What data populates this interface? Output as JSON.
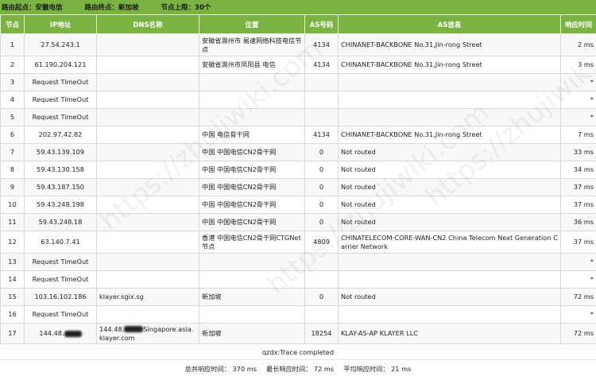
{
  "header": {
    "origin": "路由起点：安徽电信",
    "destination": "路由终点：新加坡",
    "hop_limit": "节点上限：30个"
  },
  "columns": [
    "节点",
    "IP地址",
    "DNS名称",
    "位置",
    "AS号码",
    "AS信息",
    "响应时间"
  ],
  "rows": [
    {
      "hop": "1",
      "ip": "27.54.243.1",
      "dns": "",
      "loc": "安徽省滁州市 易速网络科技电信节点",
      "as": "4134",
      "asinfo": "CHINANET-BACKBONE No.31,Jin-rong Street",
      "time": "2 ms"
    },
    {
      "hop": "2",
      "ip": "61.190.204.121",
      "dns": "",
      "loc": "安徽省滁州市凤阳县 电信",
      "as": "4134",
      "asinfo": "CHINANET-BACKBONE No.31,Jin-rong Street",
      "time": "3 ms"
    },
    {
      "hop": "3",
      "ip": "Request TimeOut",
      "dns": "",
      "loc": "",
      "as": "",
      "asinfo": "",
      "time": "*"
    },
    {
      "hop": "4",
      "ip": "Request TimeOut",
      "dns": "",
      "loc": "",
      "as": "",
      "asinfo": "",
      "time": "*"
    },
    {
      "hop": "5",
      "ip": "Request TimeOut",
      "dns": "",
      "loc": "",
      "as": "",
      "asinfo": "",
      "time": "*"
    },
    {
      "hop": "6",
      "ip": "202.97.42.82",
      "dns": "",
      "loc": "中国 电信骨干网",
      "as": "4134",
      "asinfo": "CHINANET-BACKBONE No.31,Jin-rong Street",
      "time": "7 ms"
    },
    {
      "hop": "7",
      "ip": "59.43.139.109",
      "dns": "",
      "loc": "中国 中国电信CN2骨干网",
      "as": "0",
      "asinfo": "Not routed",
      "time": "33 ms"
    },
    {
      "hop": "8",
      "ip": "59.43.130.158",
      "dns": "",
      "loc": "中国 中国电信CN2骨干网",
      "as": "0",
      "asinfo": "Not routed",
      "time": "34 ms"
    },
    {
      "hop": "9",
      "ip": "59.43.187.150",
      "dns": "",
      "loc": "中国 中国电信CN2骨干网",
      "as": "0",
      "asinfo": "Not routed",
      "time": "37 ms"
    },
    {
      "hop": "10",
      "ip": "59.43.248.198",
      "dns": "",
      "loc": "中国 中国电信CN2骨干网",
      "as": "0",
      "asinfo": "Not routed",
      "time": "37 ms"
    },
    {
      "hop": "11",
      "ip": "59.43.248.18",
      "dns": "",
      "loc": "中国 中国电信CN2骨干网",
      "as": "0",
      "asinfo": "Not routed",
      "time": "36 ms"
    },
    {
      "hop": "12",
      "ip": "63.140.7.41",
      "dns": "",
      "loc": "香港 中国电信CN2骨干网CTGNet节点",
      "as": "4809",
      "asinfo": "CHINATELECOM-CORE-WAN-CN2 China Telecom Next Generation Carrier Network",
      "time": "37 ms"
    },
    {
      "hop": "13",
      "ip": "Request TimeOut",
      "dns": "",
      "loc": "",
      "as": "",
      "asinfo": "",
      "time": "*"
    },
    {
      "hop": "14",
      "ip": "Request TimeOut",
      "dns": "",
      "loc": "",
      "as": "",
      "asinfo": "",
      "time": "*"
    },
    {
      "hop": "15",
      "ip": "103.16.102.186",
      "dns": "klayer.sgix.sg",
      "loc": "新加坡",
      "as": "0",
      "asinfo": "Not routed",
      "time": "72 ms"
    },
    {
      "hop": "16",
      "ip": "Request TimeOut",
      "dns": "",
      "loc": "",
      "as": "",
      "asinfo": "",
      "time": "*"
    },
    {
      "hop": "17",
      "ip": "144.48.",
      "dns": "144.48.",
      "dns_suffix": "Singapore.asia.klayer.com",
      "loc": "新加坡",
      "as": "18254",
      "asinfo": "KLAY-AS-AP KLAYER LLC",
      "time": "72 ms"
    }
  ],
  "footer": {
    "status": "qzdx:Trace completed",
    "total": "总共响应时间： 370 ms",
    "max": "最长响应时间： 72 ms",
    "avg": "平均响应时间： 21 ms"
  },
  "watermark": "https://zhujiwiki.com"
}
